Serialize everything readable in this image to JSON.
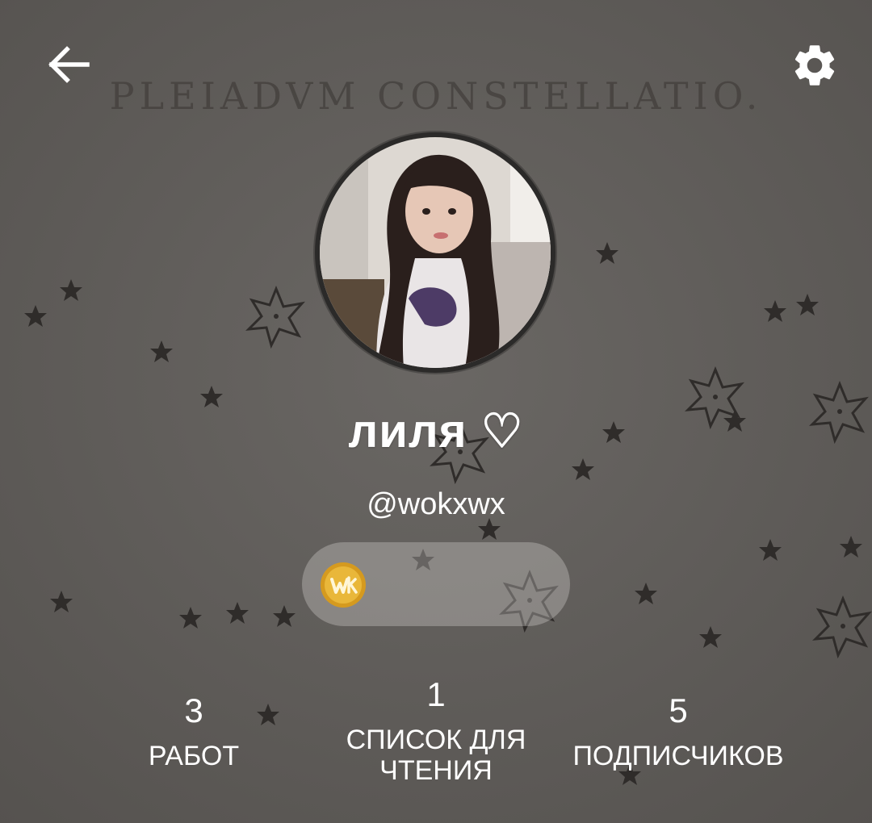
{
  "header": {
    "background_caption": "PLEIADVM CONSTELLATIO.",
    "back_icon": "arrow-left-icon",
    "settings_icon": "gear-icon"
  },
  "profile": {
    "display_name": "лиля ♡",
    "username": "@wokxwx",
    "coin_icon": "wattpad-coin-icon"
  },
  "stats": {
    "works": {
      "value": "3",
      "label": "РАБОТ"
    },
    "reading_lists": {
      "value": "1",
      "label": "СПИСОК ДЛЯ ЧТЕНИЯ"
    },
    "followers": {
      "value": "5",
      "label": "ПОДПИСЧИКОВ"
    }
  },
  "colors": {
    "background": "#5f5c5a",
    "text": "#ffffff",
    "coin": "#e3b234"
  }
}
